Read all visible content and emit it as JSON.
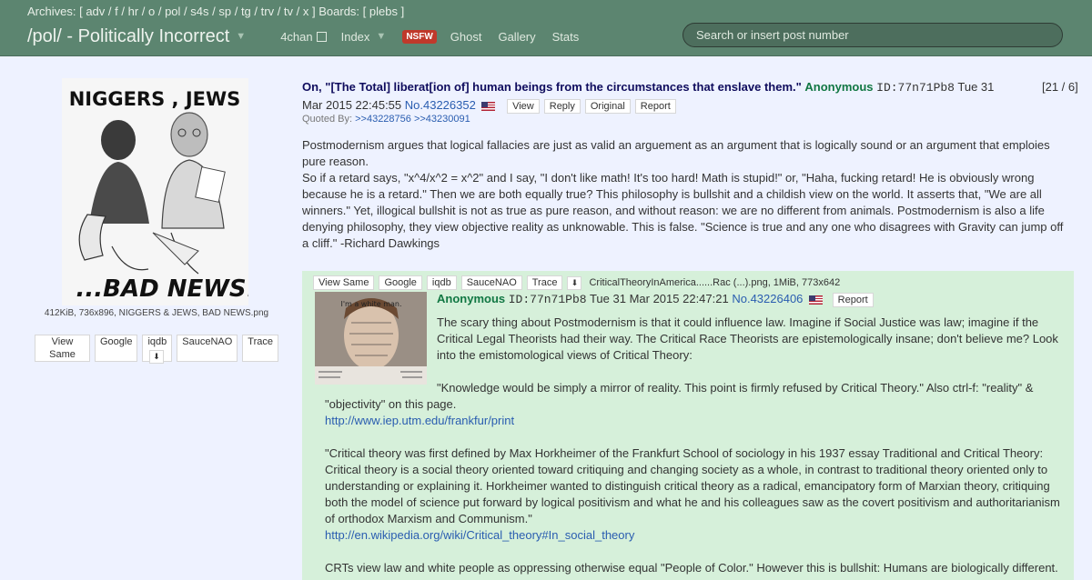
{
  "topbar": {
    "archives_label": "Archives:",
    "archives": [
      "adv",
      "f",
      "hr",
      "o",
      "pol",
      "s4s",
      "sp",
      "tg",
      "trv",
      "tv",
      "x"
    ],
    "boards_label": "Boards:",
    "boards": [
      "plebs"
    ],
    "board_title": "/pol/ - Politically Incorrect",
    "nav": {
      "fourchan": "4chan",
      "index": "Index",
      "nsfw": "NSFW",
      "ghost": "Ghost",
      "gallery": "Gallery",
      "stats": "Stats"
    },
    "search_placeholder": "Search or insert post number"
  },
  "op": {
    "thumb_text_top": "NIGGERS , JEWS",
    "thumb_text_bottom": "...BAD NEWS!",
    "file_meta": "412KiB, 736x896, NIGGERS & JEWS, BAD NEWS.png",
    "file_buttons": [
      "View Same",
      "Google",
      "iqdb",
      "SauceNAO",
      "Trace"
    ],
    "subject": "On, \"[The Total] liberat[ion of] human beings from the circumstances that enslave them.\"",
    "name": "Anonymous",
    "poster_id": "ID:77n71Pb8",
    "date": "Tue 31 Mar 2015 22:45:55",
    "post_no": "No.43226352",
    "post_buttons": [
      "View",
      "Reply",
      "Original",
      "Report"
    ],
    "counter": "[21 / 6]",
    "quoted_by_label": "Quoted By:",
    "quoted_by": ">>43228756 >>43230091",
    "body": [
      "Postmodernism argues that logical fallacies are just as valid an arguement as an argument that is logically sound or an argument that emploies pure reason.",
      "So if a retard says, \"x^4/x^2 = x^2\" and I say, \"I don't like math! It's too hard! Math is stupid!\" or, \"Haha, fucking retard! He is obviously wrong because he is a retard.\" Then we are both equally true? This philosophy is bullshit and a childish view on the world. It asserts that, \"We are all winners.\" Yet, illogical bullshit is not as true as pure reason, and without reason: we are no different from animals. Postmodernism is also a life denying philosophy, they view objective reality as unknowable. This is false. \"Science is true and any one who disagrees with Gravity can jump off a cliff.\" -Richard Dawkings"
    ]
  },
  "reply": {
    "file_buttons": [
      "View Same",
      "Google",
      "iqdb",
      "SauceNAO",
      "Trace"
    ],
    "filename": "CriticalTheoryInAmerica......Rac (...).png, 1MiB, 773x642",
    "thumb_text": "I'm a white man.",
    "name": "Anonymous",
    "poster_id": "ID:77n71Pb8",
    "date": "Tue 31 Mar 2015 22:47:21",
    "post_no": "No.43226406",
    "report": "Report",
    "body_intro": "The scary thing about Postmodernism is that it could influence law. Imagine if Social Justice was law; imagine if the Critical Legal Theorists had their way. The Critical Race Theorists are epistemologically insane; don't believe me? Look into the emistomological views of Critical Theory:",
    "quote1_start": "\"Knowledge would be simply a mirror of reality. This point is firmly refused by Critical Theory.\" Also ctrl-f: \"reality\" &",
    "quote1_end": "\"objectivity\" on this page.",
    "link1": "http://www.iep.utm.edu/frankfur/print",
    "quote2": "\"Critical theory was first defined by Max Horkheimer of the Frankfurt School of sociology in his 1937 essay Traditional and Critical Theory: Critical theory is a social theory oriented toward critiquing and changing society as a whole, in contrast to traditional theory oriented only to understanding or explaining it. Horkheimer wanted to distinguish critical theory as a radical, emancipatory form of Marxian theory, critiquing both the model of science put forward by logical positivism and what he and his colleagues saw as the covert positivism and authoritarianism of orthodox Marxism and Communism.\"",
    "link2": "http://en.wikipedia.org/wiki/Critical_theory#In_social_theory",
    "last_line": "CRTs view law and white people as oppressing otherwise equal \"People of Color.\" However this is bullshit: Humans are biologically different."
  }
}
